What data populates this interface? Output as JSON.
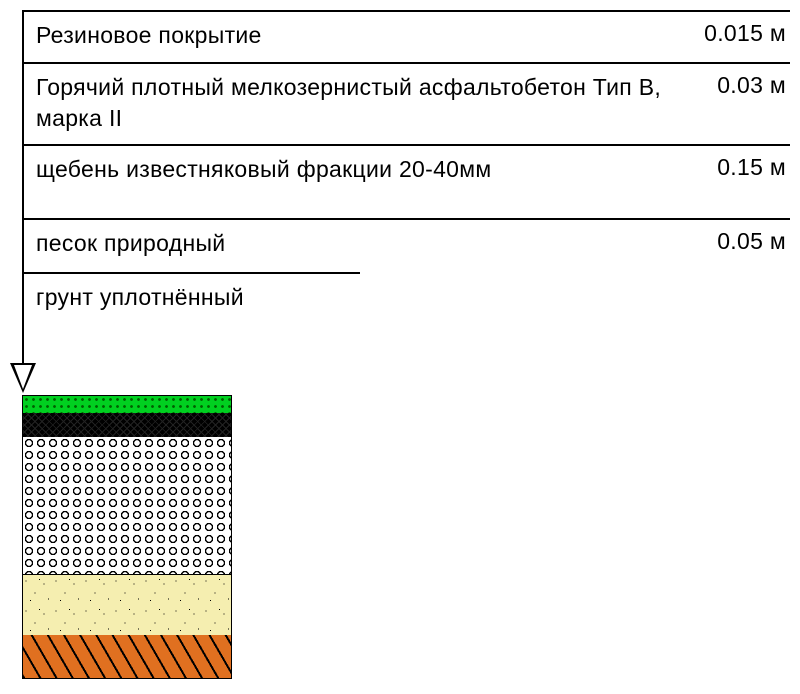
{
  "layers": [
    {
      "label": "Резиновое покрытие",
      "thickness": "0.015 м"
    },
    {
      "label": "Горячий плотный мелкозернистый асфальтобетон Тип В, марка II",
      "thickness": "0.03 м"
    },
    {
      "label": "щебень известняковый фракции 20-40мм",
      "thickness": "0.15 м"
    },
    {
      "label": "песок природный",
      "thickness": "0.05 м"
    },
    {
      "label": "грунт уплотнённый",
      "thickness": ""
    }
  ],
  "colors": {
    "rubber": "#00D020",
    "asphalt": "#000000",
    "gravel": "#FFFFFF",
    "sand": "#F5EEB0",
    "soil": "#E07020"
  }
}
